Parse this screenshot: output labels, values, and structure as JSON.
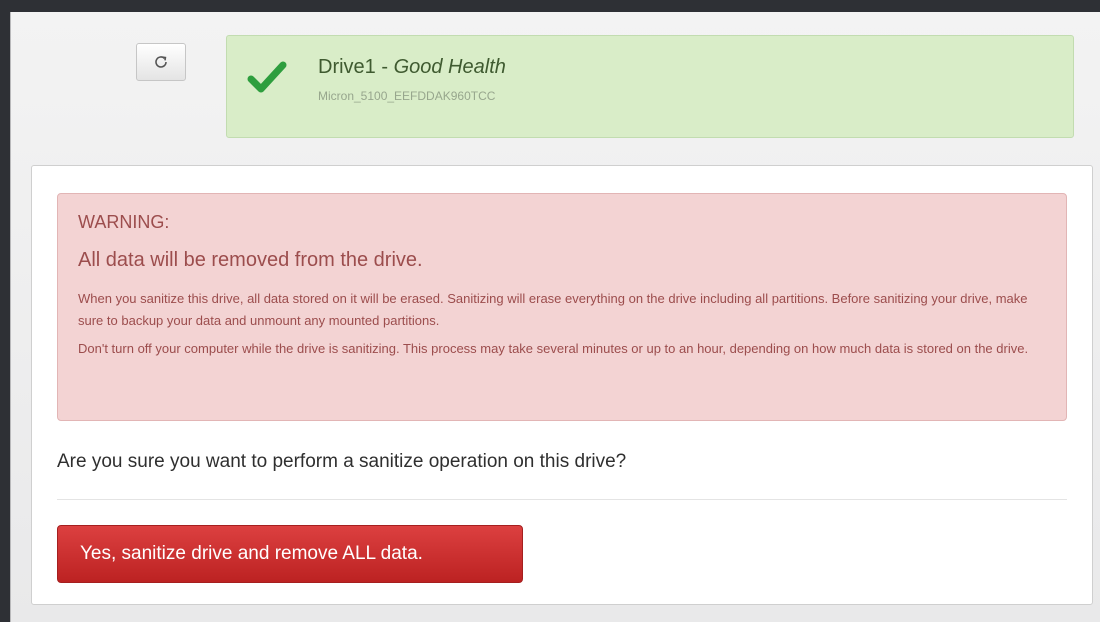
{
  "toolbar": {
    "refresh_icon": "refresh-icon"
  },
  "drive": {
    "name": "Drive1",
    "separator": " - ",
    "health": "Good Health",
    "model": "Micron_5100_EEFDDAK960TCC",
    "status_icon": "checkmark-icon",
    "status_color": "#2e9e3e"
  },
  "warning": {
    "title": "WARNING:",
    "headline": "All data will be removed from the drive.",
    "paragraph1": "When you sanitize this drive, all data stored on it will be erased. Sanitizing will erase everything on the drive including all partitions. Before sanitizing your drive, make sure to backup your data and unmount any mounted partitions.",
    "paragraph2": "Don't turn off your computer while the drive is sanitizing. This process may take several minutes or up to an hour, depending on how much data is stored on the drive."
  },
  "confirm": {
    "question": "Are you sure you want to perform a sanitize operation on this drive?",
    "button_label": "Yes, sanitize drive and remove ALL data.",
    "button_color": "#c82b2b"
  }
}
